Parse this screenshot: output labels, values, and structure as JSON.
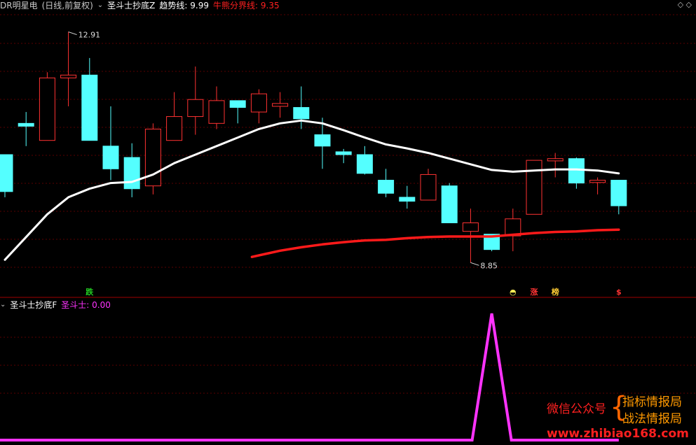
{
  "header": {
    "stock_name": "DR明星电",
    "adjust_mode": "(日线,前复权)",
    "indicator_main": "圣斗士抄底Z",
    "trend_label": "趋势线:",
    "trend_value": "9.99",
    "bull_label": "牛熊分界线:",
    "bull_value": "9.35",
    "indicator_sub": "圣斗士抄底F",
    "sds_label": "圣斗士:",
    "sds_value": "0.00",
    "top_right_icons": "◇ ◇"
  },
  "watermark": {
    "left": "微信公众号",
    "right1": "指标情报局",
    "right2": "战法情报局",
    "url": "www.zhibiao168.com"
  },
  "chart_data": [
    {
      "type": "candlestick",
      "title": "圣斗士抄底Z",
      "ylim": [
        8.3,
        13.2
      ],
      "annotations": [
        {
          "text": "12.91",
          "index": 3
        },
        {
          "text": "8.85",
          "index": 22
        }
      ],
      "markers": [
        {
          "text": "跌",
          "index": 4,
          "color": "#22cc22"
        },
        {
          "text": "◓",
          "index": 24,
          "color": "#ffee55"
        },
        {
          "text": "涨",
          "index": 25,
          "color": "#ff3333"
        },
        {
          "text": "榜",
          "index": 26,
          "color": "#ffcc33"
        },
        {
          "text": "$",
          "index": 29,
          "color": "#ff3333"
        }
      ],
      "candles": [
        {
          "o": 10.75,
          "h": 10.75,
          "l": 10.0,
          "c": 10.1
        },
        {
          "o": 11.3,
          "h": 11.5,
          "l": 10.9,
          "c": 11.25
        },
        {
          "o": 11.0,
          "h": 12.2,
          "l": 11.0,
          "c": 12.1
        },
        {
          "o": 12.1,
          "h": 12.91,
          "l": 11.6,
          "c": 12.15
        },
        {
          "o": 12.15,
          "h": 12.45,
          "l": 11.0,
          "c": 11.0
        },
        {
          "o": 10.9,
          "h": 11.6,
          "l": 10.3,
          "c": 10.5
        },
        {
          "o": 10.7,
          "h": 10.95,
          "l": 10.0,
          "c": 10.15
        },
        {
          "o": 10.2,
          "h": 11.3,
          "l": 10.05,
          "c": 11.2
        },
        {
          "o": 11.0,
          "h": 11.85,
          "l": 11.0,
          "c": 11.42
        },
        {
          "o": 11.42,
          "h": 12.3,
          "l": 11.1,
          "c": 11.72
        },
        {
          "o": 11.3,
          "h": 11.95,
          "l": 11.2,
          "c": 11.7
        },
        {
          "o": 11.7,
          "h": 11.7,
          "l": 11.3,
          "c": 11.58
        },
        {
          "o": 11.5,
          "h": 11.9,
          "l": 11.3,
          "c": 11.82
        },
        {
          "o": 11.6,
          "h": 11.85,
          "l": 11.4,
          "c": 11.65
        },
        {
          "o": 11.58,
          "h": 11.95,
          "l": 11.2,
          "c": 11.38
        },
        {
          "o": 11.1,
          "h": 11.4,
          "l": 10.5,
          "c": 10.9
        },
        {
          "o": 10.8,
          "h": 10.85,
          "l": 10.6,
          "c": 10.75
        },
        {
          "o": 10.75,
          "h": 10.9,
          "l": 10.4,
          "c": 10.42
        },
        {
          "o": 10.3,
          "h": 10.5,
          "l": 10.0,
          "c": 10.07
        },
        {
          "o": 10.0,
          "h": 10.2,
          "l": 9.8,
          "c": 9.93
        },
        {
          "o": 9.95,
          "h": 10.5,
          "l": 9.95,
          "c": 10.4
        },
        {
          "o": 10.2,
          "h": 10.25,
          "l": 9.55,
          "c": 9.55
        },
        {
          "o": 9.4,
          "h": 9.8,
          "l": 8.85,
          "c": 9.55
        },
        {
          "o": 9.35,
          "h": 9.35,
          "l": 9.05,
          "c": 9.08
        },
        {
          "o": 9.32,
          "h": 9.8,
          "l": 9.05,
          "c": 9.62
        },
        {
          "o": 9.7,
          "h": 10.65,
          "l": 9.7,
          "c": 10.65
        },
        {
          "o": 10.64,
          "h": 10.78,
          "l": 10.35,
          "c": 10.68
        },
        {
          "o": 10.68,
          "h": 10.7,
          "l": 10.15,
          "c": 10.25
        },
        {
          "o": 10.26,
          "h": 10.35,
          "l": 10.05,
          "c": 10.3
        },
        {
          "o": 10.3,
          "h": 10.3,
          "l": 9.7,
          "c": 9.85
        }
      ],
      "series": [
        {
          "name": "趋势线",
          "color": "#ffffff",
          "values": [
            8.9,
            9.3,
            9.7,
            10.0,
            10.15,
            10.25,
            10.27,
            10.4,
            10.6,
            10.75,
            10.9,
            11.05,
            11.2,
            11.3,
            11.35,
            11.3,
            11.18,
            11.05,
            10.93,
            10.86,
            10.78,
            10.68,
            10.58,
            10.48,
            10.45,
            10.47,
            10.49,
            10.49,
            10.47,
            10.42
          ]
        },
        {
          "name": "牛熊分界线",
          "color": "#ff1a1a",
          "start_index": 12,
          "values": [
            8.95,
            9.06,
            9.12,
            9.17,
            9.21,
            9.24,
            9.25,
            9.28,
            9.3,
            9.31,
            9.31,
            9.31,
            9.34,
            9.37,
            9.39,
            9.4,
            9.42,
            9.43
          ]
        }
      ]
    },
    {
      "type": "line",
      "title": "圣斗士抄底F",
      "ylim": [
        0,
        1
      ],
      "series": [
        {
          "name": "圣斗士",
          "color": "#ff33ff",
          "values": [
            0,
            0,
            0,
            0,
            0,
            0,
            0,
            0,
            0,
            0,
            0,
            0,
            0,
            0,
            0,
            0,
            0,
            0,
            0,
            0,
            0,
            0,
            0,
            1,
            0,
            0,
            0,
            0,
            0,
            0
          ]
        }
      ]
    }
  ]
}
